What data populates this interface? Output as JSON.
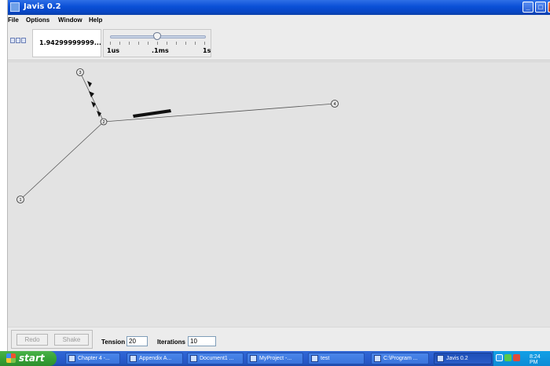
{
  "window": {
    "title": "Javis 0.2",
    "controls": {
      "minimize": "_",
      "maximize": "□",
      "close": "×"
    }
  },
  "menu": {
    "file": "File",
    "options": "Options",
    "window": "Window",
    "help": "Help"
  },
  "toolbar": {
    "value_display": "1.94299999999...",
    "slider": {
      "min_label": "1us",
      "mid_label": ".1ms",
      "max_label": "1s"
    }
  },
  "graph": {
    "nodes": [
      {
        "id": "n1",
        "label": "1"
      },
      {
        "id": "n2",
        "label": "2"
      },
      {
        "id": "n3",
        "label": "3"
      },
      {
        "id": "n4",
        "label": "4"
      }
    ],
    "edges": [
      {
        "from": "n1",
        "to": "n2"
      },
      {
        "from": "n2",
        "to": "n3"
      },
      {
        "from": "n2",
        "to": "n4"
      }
    ]
  },
  "controls": {
    "redo_label": "Redo",
    "shake_label": "Shake",
    "tension_label": "Tension",
    "tension_value": "20",
    "iterations_label": "Iterations",
    "iterations_value": "10"
  },
  "taskbar": {
    "start_label": "start",
    "items": [
      "Chapter 4 -...",
      "Appendix A...",
      "Document1 ...",
      "MyProject -...",
      "test",
      "C:\\Program ...",
      "Javis 0.2"
    ],
    "clock": "8:24 PM"
  },
  "colors": {
    "titlebar": "#0a4fd6",
    "canvas": "#e3e3e3",
    "taskbar": "#2656c4",
    "start": "#36a336"
  }
}
